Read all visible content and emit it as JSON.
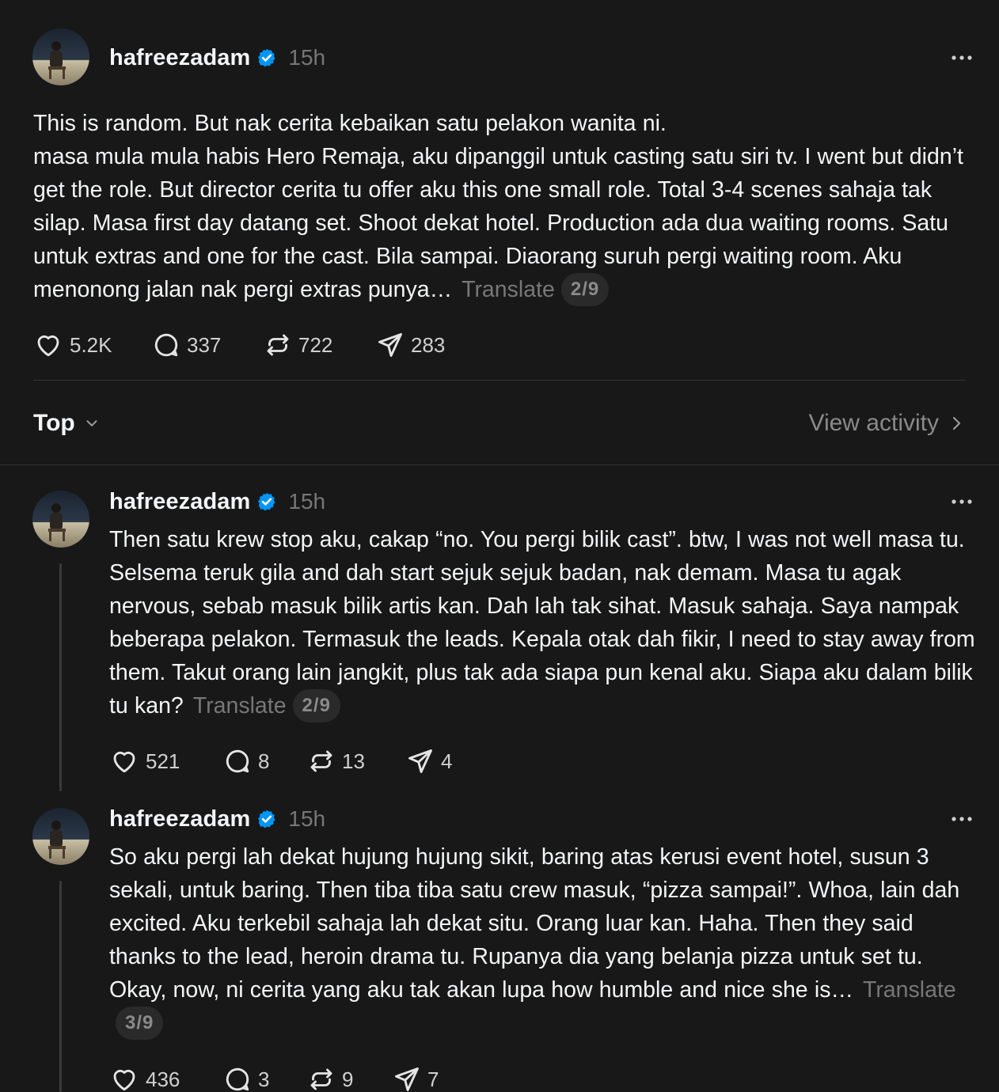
{
  "colors": {
    "background": "#181818",
    "text_primary": "#f3f5f7",
    "text_secondary": "#777777",
    "verified_blue": "#0095f6",
    "divider": "#333333"
  },
  "main_post": {
    "username": "hafreezadam",
    "verified": true,
    "time": "15h",
    "body": [
      "This is random. But nak cerita kebaikan satu pelakon wanita ni.",
      "masa mula mula habis Hero Remaja, aku dipanggil untuk casting satu siri tv. I went but didn’t get the role. But director cerita tu offer aku this one small role. Total 3-4 scenes sahaja tak silap. Masa first day datang set. Shoot dekat hotel. Production ada dua waiting rooms. Satu untuk extras and one for the cast. Bila sampai. Diaorang suruh pergi waiting room. Aku menonong jalan nak pergi extras punya…"
    ],
    "translate_label": "Translate",
    "page_indicator": "2/9",
    "likes": "5.2K",
    "replies": "337",
    "reposts": "722",
    "shares": "283"
  },
  "sort": {
    "label": "Top",
    "icon": "chevron-down-icon"
  },
  "view_activity": {
    "label": "View activity",
    "icon": "chevron-right-icon"
  },
  "replies": [
    {
      "username": "hafreezadam",
      "verified": true,
      "time": "15h",
      "body": "Then satu krew stop aku, cakap “no. You pergi bilik cast”. btw, I was not well masa tu. Selsema teruk gila and dah start sejuk sejuk badan, nak demam. Masa tu agak nervous, sebab masuk bilik artis kan. Dah lah tak sihat. Masuk sahaja. Saya nampak beberapa pelakon. Termasuk the leads. Kepala otak dah fikir, I need to stay away from them. Takut orang lain jangkit, plus tak ada siapa pun kenal aku. Siapa aku dalam bilik tu kan?",
      "translate_label": "Translate",
      "page_indicator": "2/9",
      "likes": "521",
      "replies": "8",
      "reposts": "13",
      "shares": "4"
    },
    {
      "username": "hafreezadam",
      "verified": true,
      "time": "15h",
      "body": "So aku pergi lah dekat hujung hujung sikit, baring atas kerusi event hotel, susun 3 sekali, untuk baring. Then tiba tiba satu crew masuk, “pizza sampai!”. Whoa, lain dah excited. Aku terkebil sahaja lah dekat situ. Orang luar kan. Haha. Then they said thanks to the lead, heroin drama tu. Rupanya dia yang belanja pizza untuk set tu. Okay, now, ni cerita yang aku tak akan lupa how humble and nice she is…",
      "translate_label": "Translate",
      "page_indicator": "3/9",
      "likes": "436",
      "replies": "3",
      "reposts": "9",
      "shares": "7"
    }
  ]
}
